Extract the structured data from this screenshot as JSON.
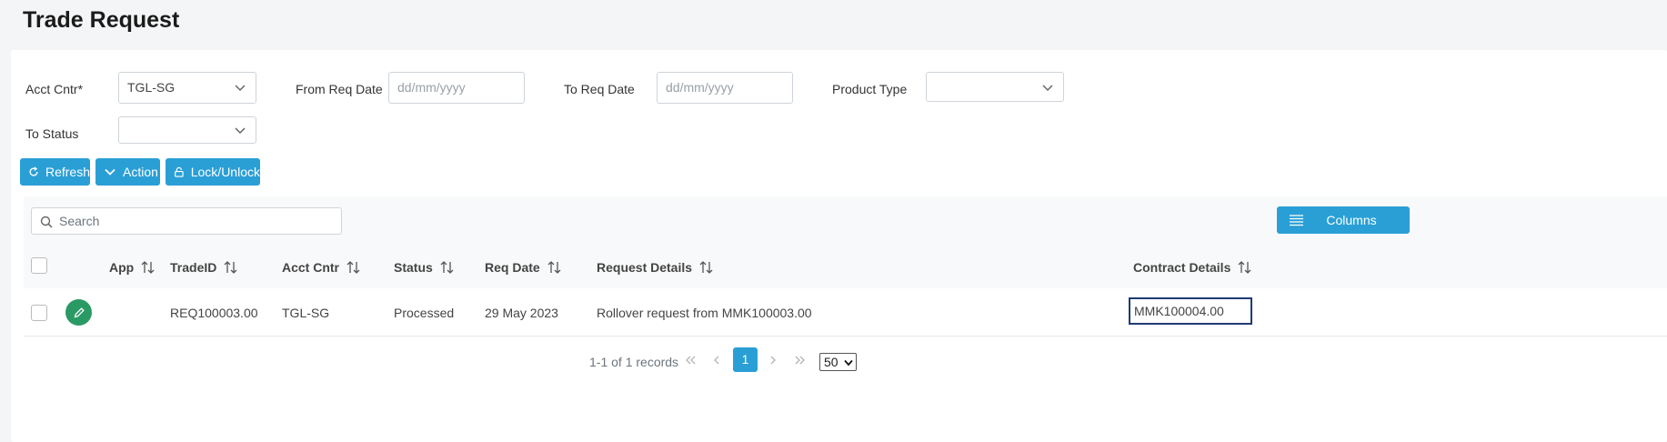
{
  "page": {
    "title": "Trade Request"
  },
  "filters": {
    "acct_cntr": {
      "label": "Acct Cntr*",
      "value": "TGL-SG"
    },
    "from_req_date": {
      "label": "From Req Date",
      "placeholder": "dd/mm/yyyy"
    },
    "to_req_date": {
      "label": "To Req Date",
      "placeholder": "dd/mm/yyyy"
    },
    "product_type": {
      "label": "Product Type",
      "value": ""
    },
    "to_status": {
      "label": "To Status",
      "value": ""
    }
  },
  "toolbar": {
    "refresh_label": "Refresh",
    "action_label": "Action",
    "lock_label": "Lock/Unlock"
  },
  "grid": {
    "search_placeholder": "Search",
    "columns_label": "Columns",
    "headers": {
      "app": "App",
      "trade_id": "TradeID",
      "acct_cntr": "Acct Cntr",
      "status": "Status",
      "req_date": "Req Date",
      "request_details": "Request Details",
      "contract_details": "Contract Details"
    },
    "rows": [
      {
        "trade_id": "REQ100003.00",
        "acct_cntr": "TGL-SG",
        "status": "Processed",
        "req_date": "29 May 2023",
        "request_details": "Rollover request from MMK100003.00",
        "contract_details": "MMK100004.00"
      }
    ]
  },
  "pagination": {
    "summary": "1-1 of 1 records",
    "current_page": "1",
    "page_size": "50"
  },
  "colors": {
    "primary": "#2a9fd6",
    "edit_button": "#2a9a64",
    "selected_cell_border": "#1f3b73"
  }
}
